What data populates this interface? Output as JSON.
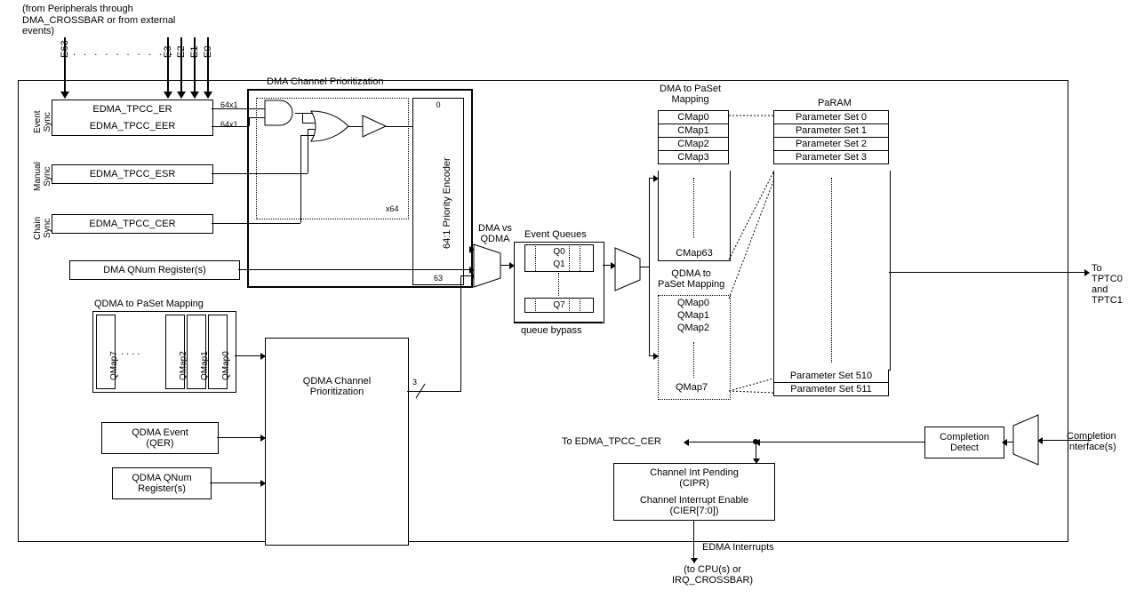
{
  "header_note": "(from Peripherals through DMA_CROSSBAR or from external events)",
  "events": {
    "e63": "E63",
    "e3": "E3",
    "e2": "E2",
    "e1": "E1",
    "e0": "E0",
    "ellipsis": ". . . . . . . . . ."
  },
  "sync_groups": {
    "event": "Event\nSync",
    "manual": "Manual\nSync",
    "chain": "Chain\nSync"
  },
  "registers": {
    "er": "EDMA_TPCC_ER",
    "eer": "EDMA_TPCC_EER",
    "esr": "EDMA_TPCC_ESR",
    "cer": "EDMA_TPCC_CER",
    "dma_qnum": "DMA QNum Register(s)",
    "qdma_event": "QDMA Event\n(QER)",
    "qdma_qnum": "QDMA QNum\nRegister(s)"
  },
  "dma_prior": {
    "title": "DMA Channel Prioritization",
    "tag64x1_a": "64x1",
    "tag64x1_b": "64x1",
    "x64": "x64",
    "top": "0",
    "bot": "63",
    "encoder": "64:1  Priority Encoder"
  },
  "qdma_map_title": "QDMA to PaSet Mapping",
  "qdma_map": {
    "q7": "QMap7",
    "q2": "QMap2",
    "q1": "QMap1",
    "q0": "QMap0"
  },
  "qdma_prior": "QDMA Channel\nPrioritization",
  "qdma_bus": "3",
  "mux_label": "DMA vs\nQDMA",
  "event_queues": {
    "title": "Event Queues",
    "q0": "Q0",
    "q1": "Q1",
    "q7": "Q7",
    "bypass": "queue bypass"
  },
  "dma_paset": {
    "title": "DMA to PaSet\nMapping",
    "c0": "CMap0",
    "c1": "CMap1",
    "c2": "CMap2",
    "c3": "CMap3",
    "c63": "CMap63"
  },
  "qdma_paset": {
    "title": "QDMA to\nPaSet Mapping",
    "q0": "QMap0",
    "q1": "QMap1",
    "q2": "QMap2",
    "q7": "QMap7"
  },
  "param": {
    "title": "PaRAM",
    "p0": "Parameter Set 0",
    "p1": "Parameter Set 1",
    "p2": "Parameter Set 2",
    "p3": "Parameter Set 3",
    "p510": "Parameter Set 510",
    "p511": "Parameter Set 511"
  },
  "out_right": "To TPTC0\nand\nTPTC1",
  "completion_detect": "Completion\nDetect",
  "completion_if": "Completion\nInterface(s)",
  "to_cer": "To EDMA_TPCC_CER",
  "int_block": {
    "cipr": "Channel Int Pending\n(CIPR)",
    "cier": "Channel Interrupt Enable\n(CIER[7:0])"
  },
  "edma_int": "EDMA Interrupts",
  "footer": "(to CPU(s) or\nIRQ_CROSSBAR)"
}
